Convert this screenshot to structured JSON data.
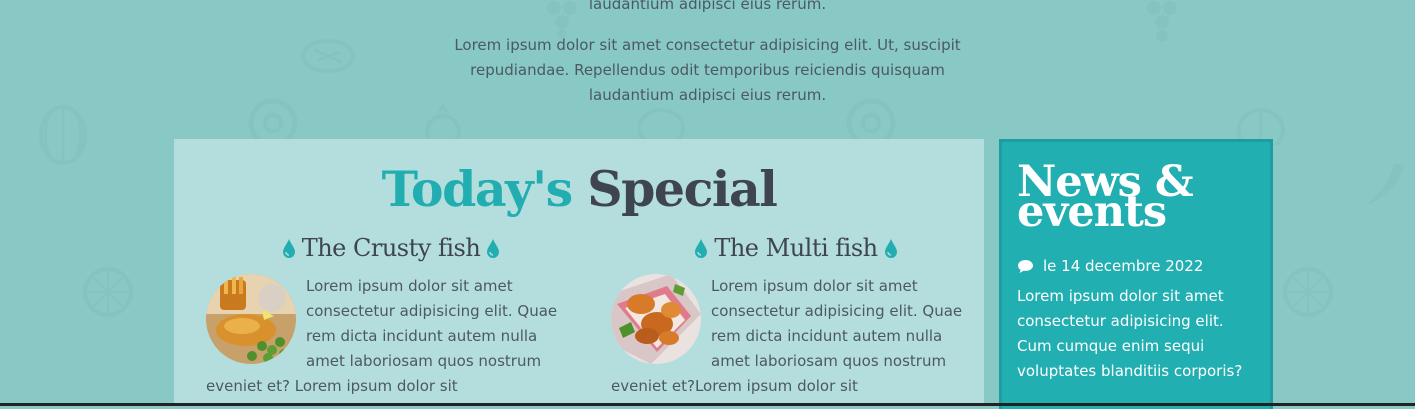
{
  "intro": {
    "top_line": "laudantium adipisci eius rerum.",
    "paragraph": "Lorem ipsum dolor sit amet consectetur adipisicing elit. Ut, suscipit repudiandae. Repellendus odit temporibus reiciendis quisquam laudantium adipisci eius rerum."
  },
  "special": {
    "title_highlight": "Today's",
    "title_rest": "Special",
    "dishes": [
      {
        "name": "The Crusty fish",
        "image_icon": "fish-and-chips-photo",
        "text": "Lorem ipsum dolor sit amet consectetur adipisicing elit. Quae rem dicta incidunt autem nulla amet laboriosam quos nostrum eveniet et? Lorem ipsum dolor sit"
      },
      {
        "name": "The Multi fish",
        "image_icon": "fried-seafood-photo",
        "text": "Lorem ipsum dolor sit amet consectetur adipisicing elit. Quae rem dicta incidunt autem nulla amet laboriosam quos nostrum eveniet et?Lorem ipsum dolor sit"
      }
    ],
    "drop_icon": "water-drop-icon"
  },
  "news": {
    "title": "News & events",
    "date_icon": "comment-icon",
    "date": "le 14 decembre 2022",
    "text": "Lorem ipsum dolor sit amet consectetur adipisicing elit. Cum cumque enim sequi voluptates blanditiis corporis?"
  },
  "colors": {
    "background": "#88c9c6",
    "accent": "#22aeb0",
    "panel": "#b4dedd",
    "dark_text": "#3e4550"
  }
}
